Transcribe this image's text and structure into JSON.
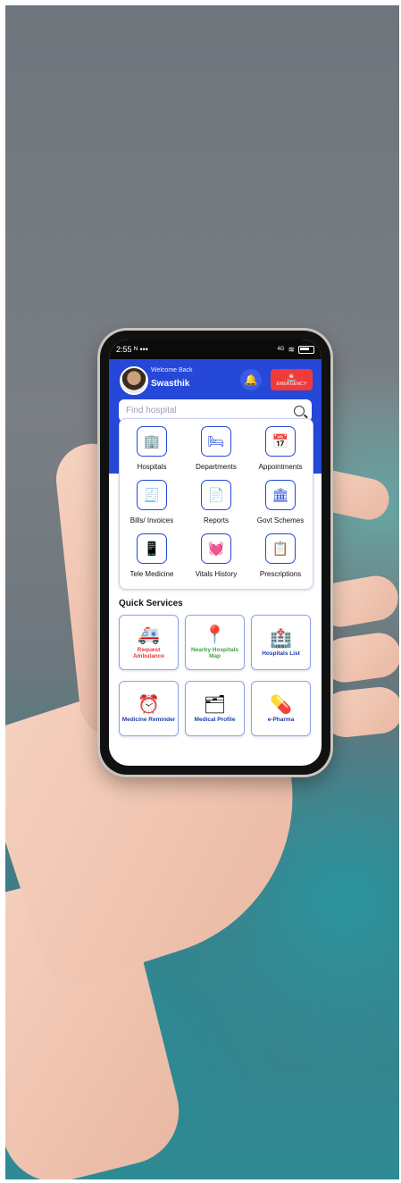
{
  "status_bar": {
    "time": "2:55",
    "notification": "ᴺ",
    "dots": "•••",
    "network": "4G",
    "wifi_icon": "wifi-icon",
    "battery_icon": "battery-icon"
  },
  "header": {
    "welcome": "Welcome Back",
    "username": "Swasthik",
    "emergency_label": "EMERGENCY",
    "bg_color": "#2548d9"
  },
  "search": {
    "placeholder": "Find hospital"
  },
  "grid_items": [
    {
      "label": "Hospitals",
      "icon": "hospital-building-icon",
      "glyph": "🏢"
    },
    {
      "label": "Departments",
      "icon": "hospital-bed-icon",
      "glyph": "🛏"
    },
    {
      "label": "Appointments",
      "icon": "calendar-check-icon",
      "glyph": "📅"
    },
    {
      "label": "Bills/ Invoices",
      "icon": "invoice-icon",
      "glyph": "🧾"
    },
    {
      "label": "Reports",
      "icon": "report-document-icon",
      "glyph": "📄"
    },
    {
      "label": "Govt Schemes",
      "icon": "government-building-icon",
      "glyph": "🏛"
    },
    {
      "label": "Tele Medicine",
      "icon": "telemedicine-phone-icon",
      "glyph": "📱"
    },
    {
      "label": "Vitals History",
      "icon": "vitals-heart-document-icon",
      "glyph": "💓"
    },
    {
      "label": "Prescriptions",
      "icon": "prescription-document-icon",
      "glyph": "📋"
    }
  ],
  "quick_services": {
    "title": "Quick Services",
    "items": [
      {
        "label": "Request Ambulance",
        "icon": "ambulance-icon",
        "glyph": "🚑",
        "color": "#e53935"
      },
      {
        "label": "Nearby Hospitals Map",
        "icon": "map-pin-icon",
        "glyph": "📍",
        "color": "#43a047"
      },
      {
        "label": "Hospitals List",
        "icon": "hospital-icon",
        "glyph": "🏥",
        "color": "#1e3aa8"
      },
      {
        "label": "Medicine Reminder",
        "icon": "alarm-clock-icon",
        "glyph": "⏰",
        "color": "#1e3aa8"
      },
      {
        "label": "Medical Profile",
        "icon": "medical-folder-icon",
        "glyph": "🗂",
        "color": "#1e3aa8"
      },
      {
        "label": "e-Pharma",
        "icon": "pharmacy-icon",
        "glyph": "💊",
        "color": "#1e3aa8"
      }
    ]
  }
}
